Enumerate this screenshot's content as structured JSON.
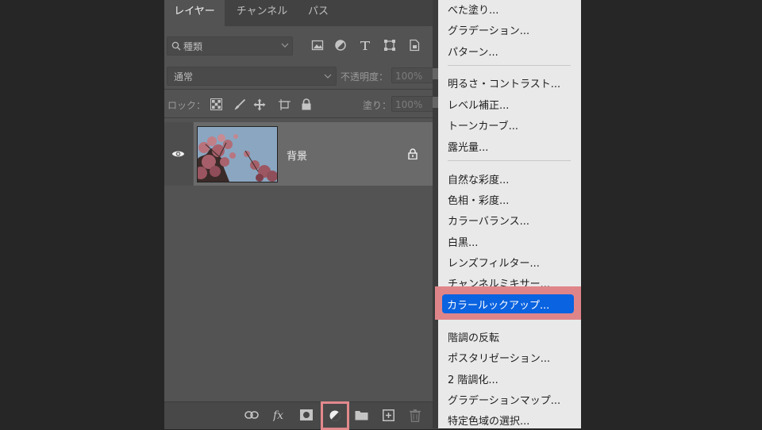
{
  "tabs": [
    "レイヤー",
    "チャンネル",
    "パス"
  ],
  "filter": {
    "kind_label": "種類"
  },
  "blend": {
    "mode": "通常",
    "opacity_label": "不透明度：",
    "opacity_value": "100%"
  },
  "lock": {
    "label": "ロック：",
    "fill_label": "塗り：",
    "fill_value": "100%"
  },
  "layer": {
    "name": "背景"
  },
  "menu": {
    "items": [
      "べた塗り...",
      "グラデーション...",
      "パターン...",
      "明るさ・コントラスト...",
      "レベル補正...",
      "トーンカーブ...",
      "露光量...",
      "自然な彩度...",
      "色相・彩度...",
      "カラーバランス...",
      "白黒...",
      "レンズフィルター...",
      "チャンネルミキサー...",
      "カラールックアップ...",
      "階調の反転",
      "ポスタリゼーション...",
      "2 階調化...",
      "グラデーションマップ...",
      "特定色域の選択..."
    ],
    "selected_index": 13
  },
  "colors": {
    "panel_bg": "#535353",
    "menu_bg": "#e9e9e9",
    "selection_blue": "#0a63e0",
    "highlight_pink": "#df8589"
  },
  "icons": [
    "search-icon",
    "image-filter-icon",
    "adjustment-filter-icon",
    "type-filter-icon",
    "shape-filter-icon",
    "smart-object-filter-icon",
    "eye-icon",
    "lock-icon",
    "link-icon",
    "fx-icon",
    "mask-icon",
    "adjustment-layer-icon",
    "folder-icon",
    "new-layer-icon",
    "trash-icon"
  ]
}
